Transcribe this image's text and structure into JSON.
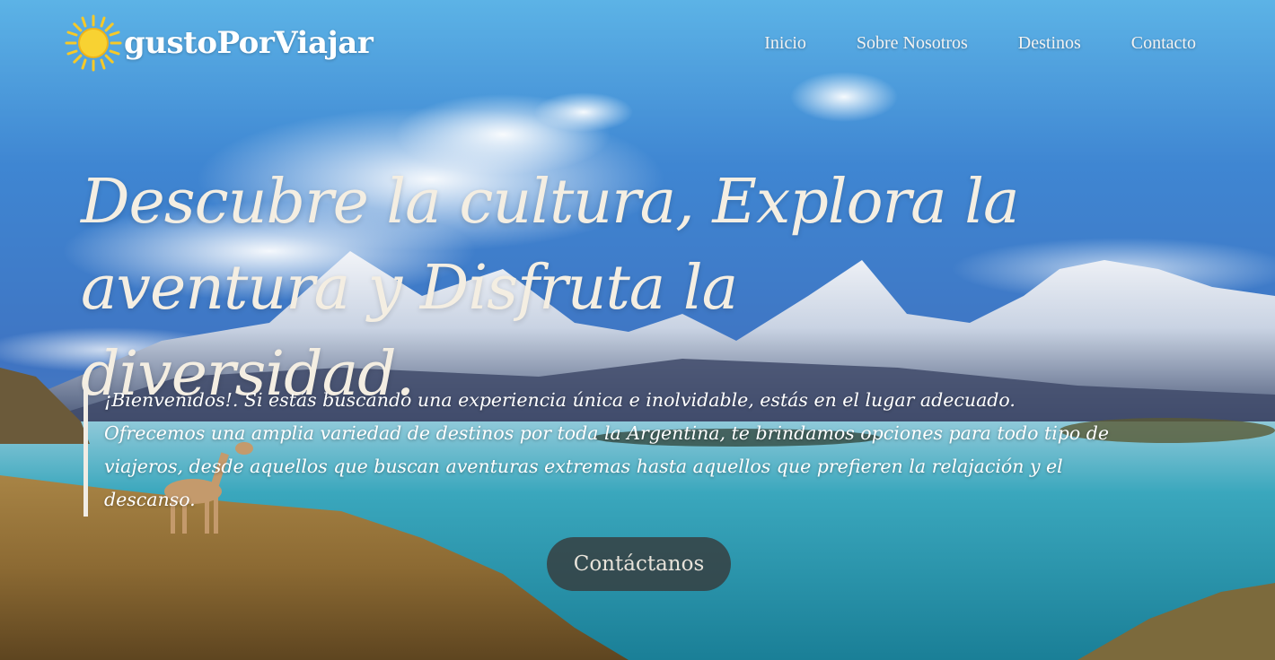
{
  "brand": {
    "name": "gustoPorViajar",
    "icon": "sun-icon"
  },
  "nav": {
    "items": [
      {
        "label": "Inicio"
      },
      {
        "label": "Sobre Nosotros"
      },
      {
        "label": "Destinos"
      },
      {
        "label": "Contacto"
      }
    ]
  },
  "hero": {
    "headline": "Descubre la cultura, Explora la aventura y Disfruta la diversidad.",
    "intro": "¡Bienvenidos!. Si estás buscando una experiencia única e inolvidable, estás en el lugar adecuado. Ofrecemos una amplia variedad de destinos por toda la Argentina, te brindamos opciones para todo tipo de viajeros, desde aquellos que buscan aventuras extremas hasta aquellos que prefieren la relajación y el descanso.",
    "cta_label": "Contáctanos",
    "background": "patagonia-mountains-lake-photo"
  },
  "colors": {
    "headline": "#f4eee2",
    "accent_bar": "#f1ece4",
    "cta_bg": "#373737",
    "sky_top": "#5aa9df",
    "lake": "#2c9fb3"
  }
}
